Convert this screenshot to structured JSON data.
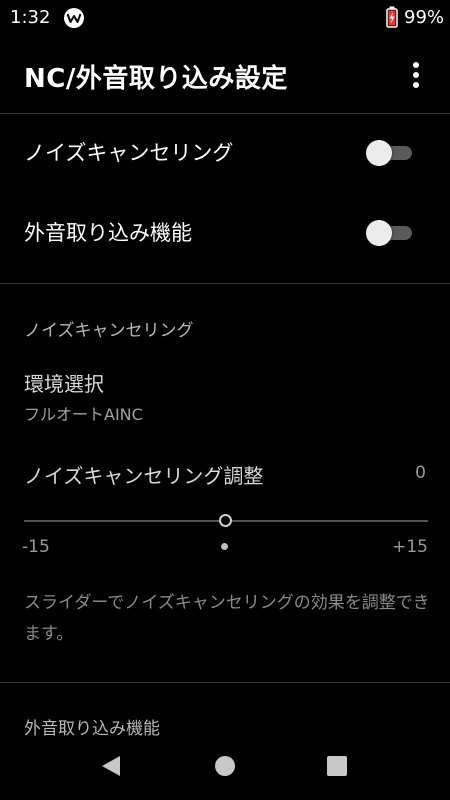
{
  "status_bar": {
    "time": "1:32",
    "battery": "99%",
    "walkman_icon": "walkman-w-icon",
    "battery_icon": "battery-charging-icon"
  },
  "header": {
    "title": "NC/外音取り込み設定",
    "menu_icon": "more-vert-icon"
  },
  "toggles": [
    {
      "label": "ノイズキャンセリング",
      "enabled": false
    },
    {
      "label": "外音取り込み機能",
      "enabled": false
    }
  ],
  "nc_section": {
    "header": "ノイズキャンセリング",
    "environment": {
      "title": "環境選択",
      "value": "フルオートAINC"
    },
    "adjust": {
      "title": "ノイズキャンセリング調整",
      "value": "0",
      "min_label": "-15",
      "max_label": "+15",
      "min": -15,
      "max": 15,
      "current": 0
    },
    "description": "スライダーでノイズキャンセリングの効果を調整できます。"
  },
  "ambient_section": {
    "header": "外音取り込み機能"
  },
  "nav": {
    "back_icon": "back-triangle-icon",
    "home_icon": "home-circle-icon",
    "recents_icon": "recents-square-icon"
  },
  "colors": {
    "background": "#000000",
    "switch_track_off": "#5a5a5a",
    "switch_thumb_off": "#ececec",
    "slider_track": "#5b5048"
  }
}
